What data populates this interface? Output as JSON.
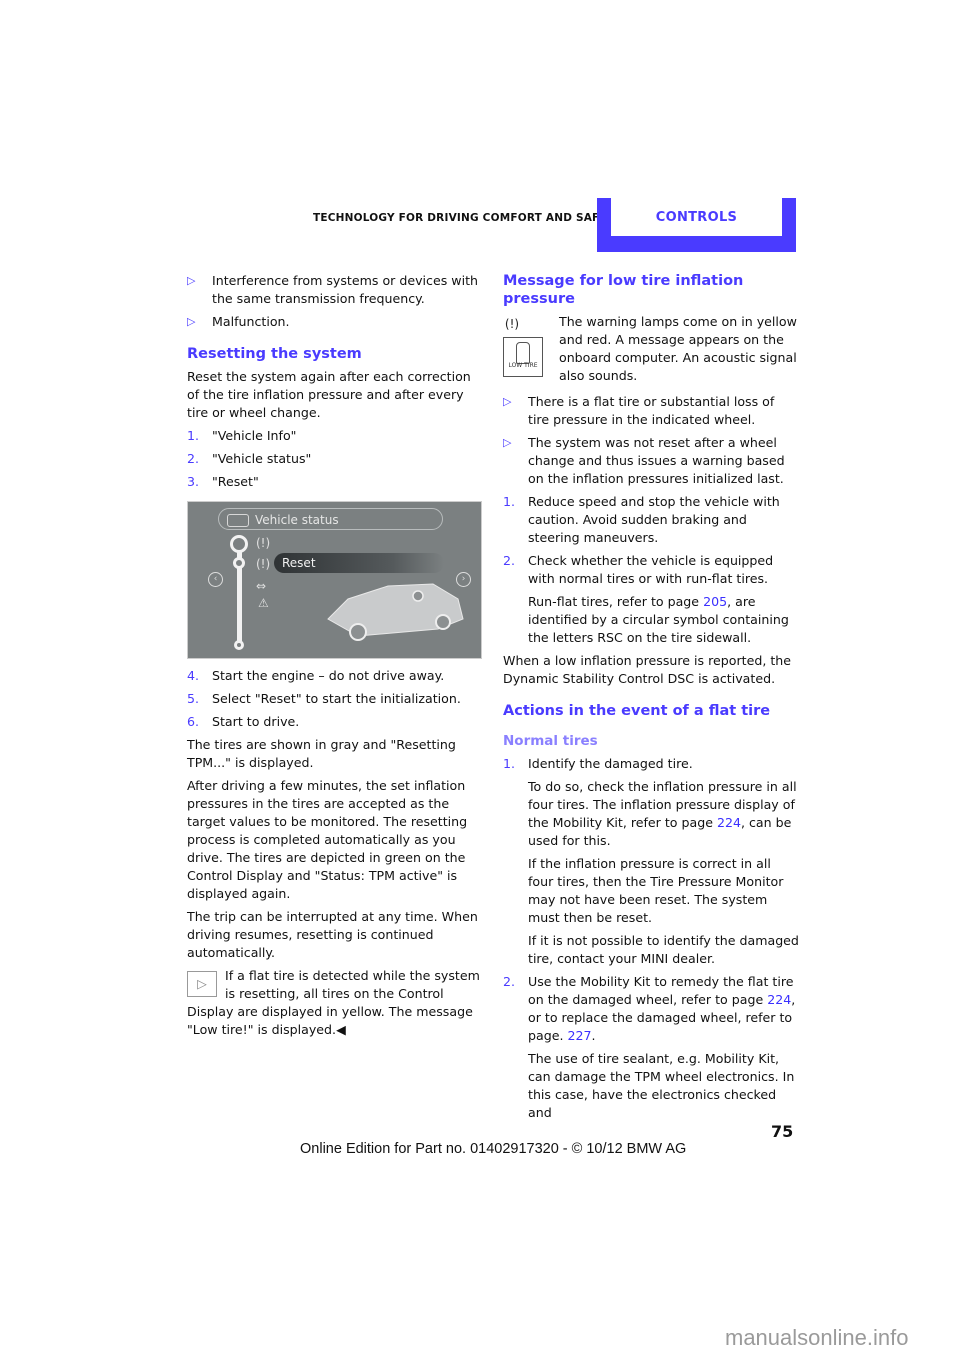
{
  "header": {
    "section": "Technology for driving comfort and safety",
    "tab": "Controls",
    "accent": "#4a3bff"
  },
  "left": {
    "bullets": [
      "Interference from systems or devices with the same transmission frequency.",
      "Malfunction."
    ],
    "reset_heading": "Resetting the system",
    "reset_intro": "Reset the system again after each correction of the tire inflation pressure and after every tire or wheel change.",
    "steps_a": [
      {
        "n": "1.",
        "text": "\"Vehicle Info\""
      },
      {
        "n": "2.",
        "text": "\"Vehicle status\""
      },
      {
        "n": "3.",
        "text": "\"Reset\""
      }
    ],
    "figure": {
      "title": "Vehicle status",
      "selected": "Reset"
    },
    "steps_b": [
      {
        "n": "4.",
        "text": "Start the engine – do not drive away."
      },
      {
        "n": "5.",
        "text": "Select \"Reset\" to start the initialization."
      },
      {
        "n": "6.",
        "text": "Start to drive."
      }
    ],
    "para1": "The tires are shown in gray and \"Resetting TPM...\" is displayed.",
    "para2": "After driving a few minutes, the set inflation pressures in the tires are accepted as the target values to be monitored. The resetting process is completed automatically as you drive. The tires are depicted in green on the Control Display and \"Status: TPM active\" is displayed again.",
    "para3": "The trip can be interrupted at any time. When driving resumes, resetting is continued automatically.",
    "note": "If a flat tire is detected while the system is resetting, all tires on the Control Display are displayed in yellow. The message \"Low tire!\" is displayed.",
    "note_end": "◀"
  },
  "right": {
    "heading1": "Message for low tire inflation pressure",
    "warn_text": "The warning lamps come on in yellow and red. A message appears on the onboard computer. An acoustic signal also sounds.",
    "warn_icon_label": "LOW TIRE",
    "bullets": [
      "There is a flat tire or substantial loss of tire pressure in the indicated wheel.",
      "The system was not reset after a wheel change and thus issues a warning based on the inflation pressures initialized last."
    ],
    "step1": {
      "n": "1.",
      "text": "Reduce speed and stop the vehicle with caution. Avoid sudden braking and steering maneuvers."
    },
    "step2": {
      "n": "2.",
      "text": "Check whether the vehicle is equipped with normal tires or with run-flat tires."
    },
    "step2_sub_pre": "Run-flat tires, refer to page ",
    "step2_sub_link": "205",
    "step2_sub_post": ", are identified by a circular symbol containing the letters RSC on the tire sidewall.",
    "dsc_para": "When a low inflation pressure is reported, the Dynamic Stability Control DSC is activated.",
    "heading2": "Actions in the event of a flat tire",
    "subheading": "Normal tires",
    "n1": {
      "n": "1.",
      "text": "Identify the damaged tire."
    },
    "n1_sub1_pre": "To do so, check the inflation pressure in all four tires. The inflation pressure display of the Mobility Kit, refer to page ",
    "n1_sub1_link": "224",
    "n1_sub1_post": ", can be used for this.",
    "n1_sub2": "If the inflation pressure is correct in all four tires, then the Tire Pressure Monitor may not have been reset. The system must then be reset.",
    "n1_sub3": "If it is not possible to identify the damaged tire, contact your MINI dealer.",
    "n2": {
      "n": "2.",
      "pre": "Use the Mobility Kit to remedy the flat tire on the damaged wheel, refer to page ",
      "link1": "224",
      "mid": ", or to replace the damaged wheel, refer to page. ",
      "link2": "227",
      "post": "."
    },
    "n2_sub": "The use of tire sealant, e.g. Mobility Kit, can damage the TPM wheel electronics. In this case, have the electronics checked and"
  },
  "footer": {
    "page": "75",
    "edition": "Online Edition for Part no. 01402917320 - © 10/12 BMW AG",
    "watermark": "manualsonline.info"
  }
}
